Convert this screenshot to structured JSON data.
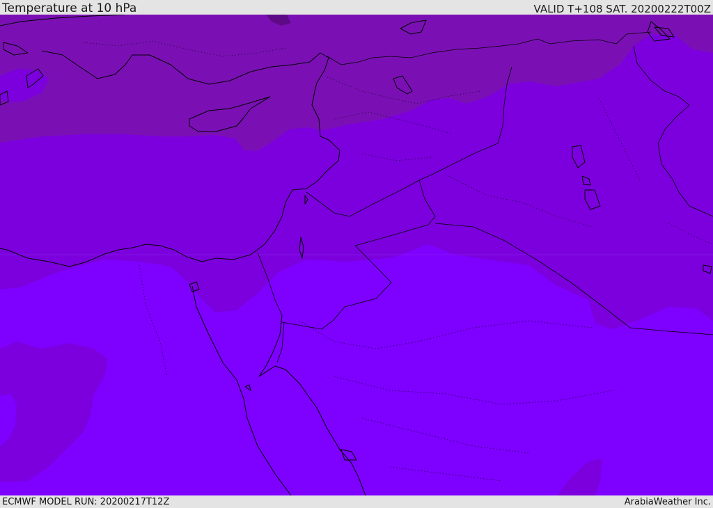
{
  "header": {
    "title": "Temperature at 10 hPa",
    "valid": "VALID T+108 SAT. 20200222T00Z"
  },
  "footer": {
    "model_run": "ECMWF MODEL RUN: 20200217T12Z",
    "credit": "ArabiaWeather Inc."
  },
  "colors": {
    "band_cold": "#7a10b4",
    "band_mid": "#7c00de",
    "band_warm": "#7e00ff",
    "band_darkest": "#5e0a86",
    "coastline": "#000000"
  },
  "map": {
    "field": "temperature",
    "level": "10 hPa",
    "region": "Eastern Mediterranean and Middle East"
  }
}
